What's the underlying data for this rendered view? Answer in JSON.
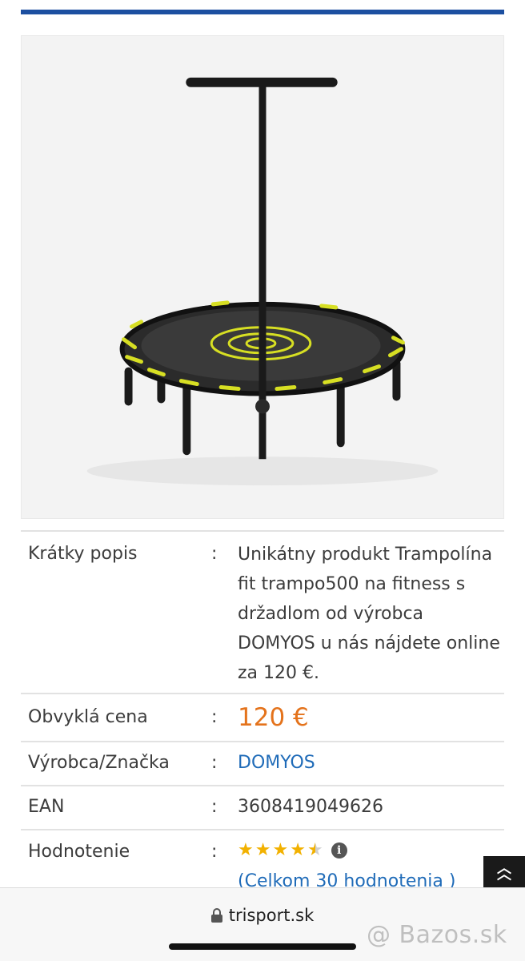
{
  "product": {
    "image_alt": "trampoline-with-handle"
  },
  "specs": {
    "description": {
      "label": "Krátky popis",
      "colon": ":",
      "lines": [
        "Unikátny produkt Trampolína",
        "fit trampo500 na fitness s",
        "držadlom od výrobca",
        "DOMYOS u nás nájdete online",
        "za 120 €."
      ]
    },
    "price": {
      "label": "Obvyklá cena",
      "colon": ":",
      "value": "120 €"
    },
    "brand": {
      "label": "Výrobca/Značka",
      "colon": ":",
      "value": "DOMYOS"
    },
    "ean": {
      "label": "EAN",
      "colon": ":",
      "value": "3608419049626"
    },
    "rating": {
      "label": "Hodnotenie",
      "colon": ":",
      "stars_value": 4.5,
      "stars_max": 5,
      "count_text": "(Celkom 30 hodnotenia )",
      "info_glyph": "i"
    }
  },
  "scroll_top": {
    "glyph": "⌃"
  },
  "browser": {
    "url": "trisport.sk"
  },
  "watermark": "@ Bazos.sk",
  "colors": {
    "top_bar": "#1c4fa0",
    "price": "#e4731c",
    "link": "#1f6bb8",
    "star": "#f2b100",
    "accent_yellow": "#d7df23"
  }
}
